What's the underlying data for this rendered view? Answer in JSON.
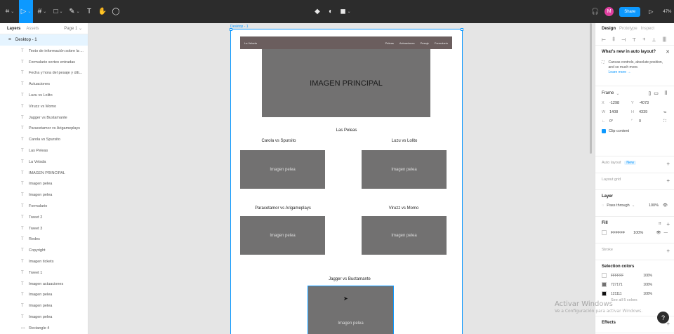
{
  "toolbar": {
    "left_tools": [
      {
        "icon": "main-menu-icon",
        "glyph": "⌗",
        "caret": "⌄"
      },
      {
        "icon": "move-tool-icon",
        "glyph": "▷",
        "caret": "⌄",
        "active": true
      },
      {
        "icon": "frame-tool-icon",
        "glyph": "#",
        "caret": "⌄"
      },
      {
        "icon": "shape-tool-icon",
        "glyph": "□",
        "caret": "⌄"
      },
      {
        "icon": "pen-tool-icon",
        "glyph": "✎",
        "caret": "⌄"
      },
      {
        "icon": "text-tool-icon",
        "glyph": "T",
        "caret": ""
      },
      {
        "icon": "hand-tool-icon",
        "glyph": "✋",
        "caret": ""
      },
      {
        "icon": "comment-tool-icon",
        "glyph": "◯",
        "caret": ""
      }
    ],
    "center_tools": [
      {
        "icon": "component-icon",
        "glyph": "◆"
      },
      {
        "icon": "mask-icon",
        "glyph": "◐"
      },
      {
        "icon": "boolean-icon",
        "glyph": "◼",
        "caret": "⌄"
      }
    ],
    "avatar_initial": "M",
    "share_label": "Share",
    "zoom": "47%"
  },
  "left_panel": {
    "tabs": [
      "Layers",
      "Assets"
    ],
    "page": "Page 1",
    "frame_name": "Desktop - 1",
    "layers": [
      "Texto de información sobre la ...",
      "Formulario sorteo entradas",
      "Fecha y hora del pesaje y últi...",
      "Actuaciones",
      "Luzu vs Lolito",
      "Viruzz vs Momo",
      "Jagger vs Bustamante",
      "Paracetamor vs Arigameplays",
      "Carola vs Spursito",
      "Las Peleas",
      "La Velada",
      "IMAGEN PRINCIPAL",
      "Imagen pelea",
      "Imagen pelea",
      "Formulario",
      "Tweet 2",
      "Tweet 3",
      "Redes",
      "Copyright",
      "Imagen tickets",
      "Tweet 1",
      "Imagen actuaciones",
      "Imagen pelea",
      "Imagen pelea",
      "Imagen pelea",
      "Rectangle 4"
    ]
  },
  "canvas": {
    "frame_label": "Desktop - 1",
    "nav": {
      "brand": "La Velada",
      "links": [
        "Peleas",
        "Actuaciones",
        "Pesaje",
        "Formulario"
      ]
    },
    "hero_text": "IMAGEN PRINCIPAL",
    "section_title": "Las Peleas",
    "fights": [
      {
        "title": "Carola vs Spursito",
        "image": "Imagen pelea"
      },
      {
        "title": "Luzu vs Lolito",
        "image": "Imagen pelea"
      },
      {
        "title": "Paracetamor vs Arigameplays",
        "image": "Imagen pelea"
      },
      {
        "title": "Viruzz vs Momo",
        "image": "Imagen pelea"
      },
      {
        "title": "Jagger vs Bustamante",
        "image": "Imagen pelea"
      }
    ]
  },
  "right_panel": {
    "tabs": [
      "Design",
      "Prototype",
      "Inspect"
    ],
    "whats_new": {
      "title": "What's new in auto layout?",
      "body": "Canvas controls, absolute position, and so much more.",
      "link": "Learn more →"
    },
    "frame": {
      "title": "Frame",
      "x": "-1298",
      "y": "-4073",
      "w": "1408",
      "h": "4339",
      "rotation": "0°",
      "radius": "0",
      "clip_content": "Clip content"
    },
    "auto_layout": {
      "title": "Auto layout",
      "badge": "New"
    },
    "layout_grid": "Layout grid",
    "layer": {
      "title": "Layer",
      "blend": "Pass through",
      "opacity": "100%"
    },
    "fill": {
      "title": "Fill",
      "hex": "FFFFFF",
      "opacity": "100%"
    },
    "stroke": "Stroke",
    "selection_colors": {
      "title": "Selection colors",
      "colors": [
        {
          "hex": "FFFFFF",
          "opacity": "100%",
          "color": "#ffffff"
        },
        {
          "hex": "727171",
          "opacity": "100%",
          "color": "#727171"
        },
        {
          "hex": "121111",
          "opacity": "100%",
          "color": "#121111"
        }
      ],
      "see_all": "See all 5 colors"
    },
    "effects": "Effects"
  },
  "watermark": {
    "line1": "Activar Windows",
    "line2": "Ve a Configuración para activar Windows."
  },
  "colors": {
    "accent": "#0d99ff",
    "toolbar": "#2c2c2c",
    "placeholder": "#727171",
    "nav": "#6b5e5e"
  }
}
